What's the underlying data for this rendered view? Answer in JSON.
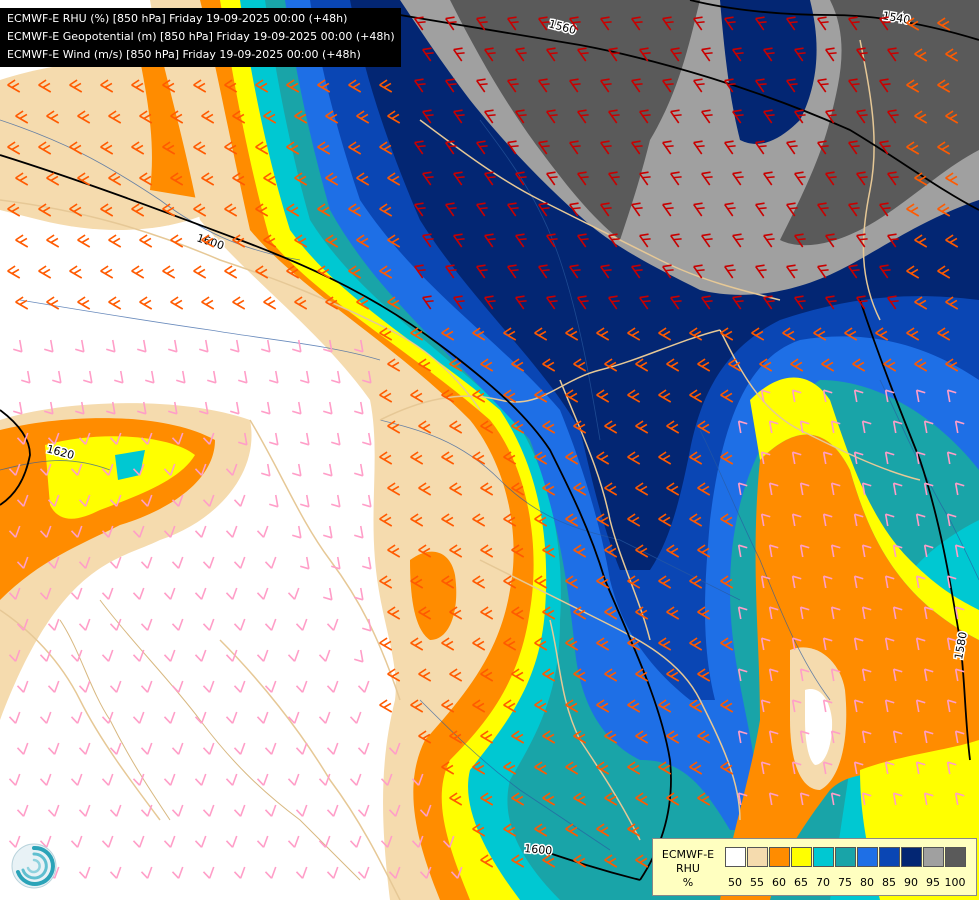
{
  "header": {
    "lines": [
      "ECMWF-E RHU (%) [850 hPa] Friday 19-09-2025 00:00 (+48h)",
      "ECMWF-E Geopotential (m) [850 hPa] Friday 19-09-2025 00:00 (+48h)",
      "ECMWF-E Wind (m/s) [850 hPa] Friday 19-09-2025 00:00 (+48h)"
    ]
  },
  "contours": {
    "labels": [
      "1560",
      "1540",
      "1600",
      "1620",
      "1600",
      "1580"
    ]
  },
  "legend": {
    "title_line1": "ECMWF-E",
    "title_line2": "RHU",
    "title_line3": "%",
    "bins": [
      {
        "label": "50",
        "color": "#ffffff"
      },
      {
        "label": "55",
        "color": "#f5dbae"
      },
      {
        "label": "60",
        "color": "#ff8c00"
      },
      {
        "label": "65",
        "color": "#ffff00"
      },
      {
        "label": "70",
        "color": "#00c8d2"
      },
      {
        "label": "75",
        "color": "#19a4a8"
      },
      {
        "label": "80",
        "color": "#1e6fe6"
      },
      {
        "label": "85",
        "color": "#0a46b4"
      },
      {
        "label": "90",
        "color": "#032673"
      },
      {
        "label": "95",
        "color": "#a0a0a0"
      },
      {
        "label": "100",
        "color": "#5a5a5a"
      }
    ]
  },
  "colors": {
    "contour": "#000000",
    "border": "#e6c896",
    "river": "#2a5aa0",
    "wind_strong": "#c80000",
    "wind_medium": "#ff5a00",
    "wind_light": "#ff9ec8"
  },
  "icons": {
    "logo": "ecmwf-swirl-icon"
  }
}
